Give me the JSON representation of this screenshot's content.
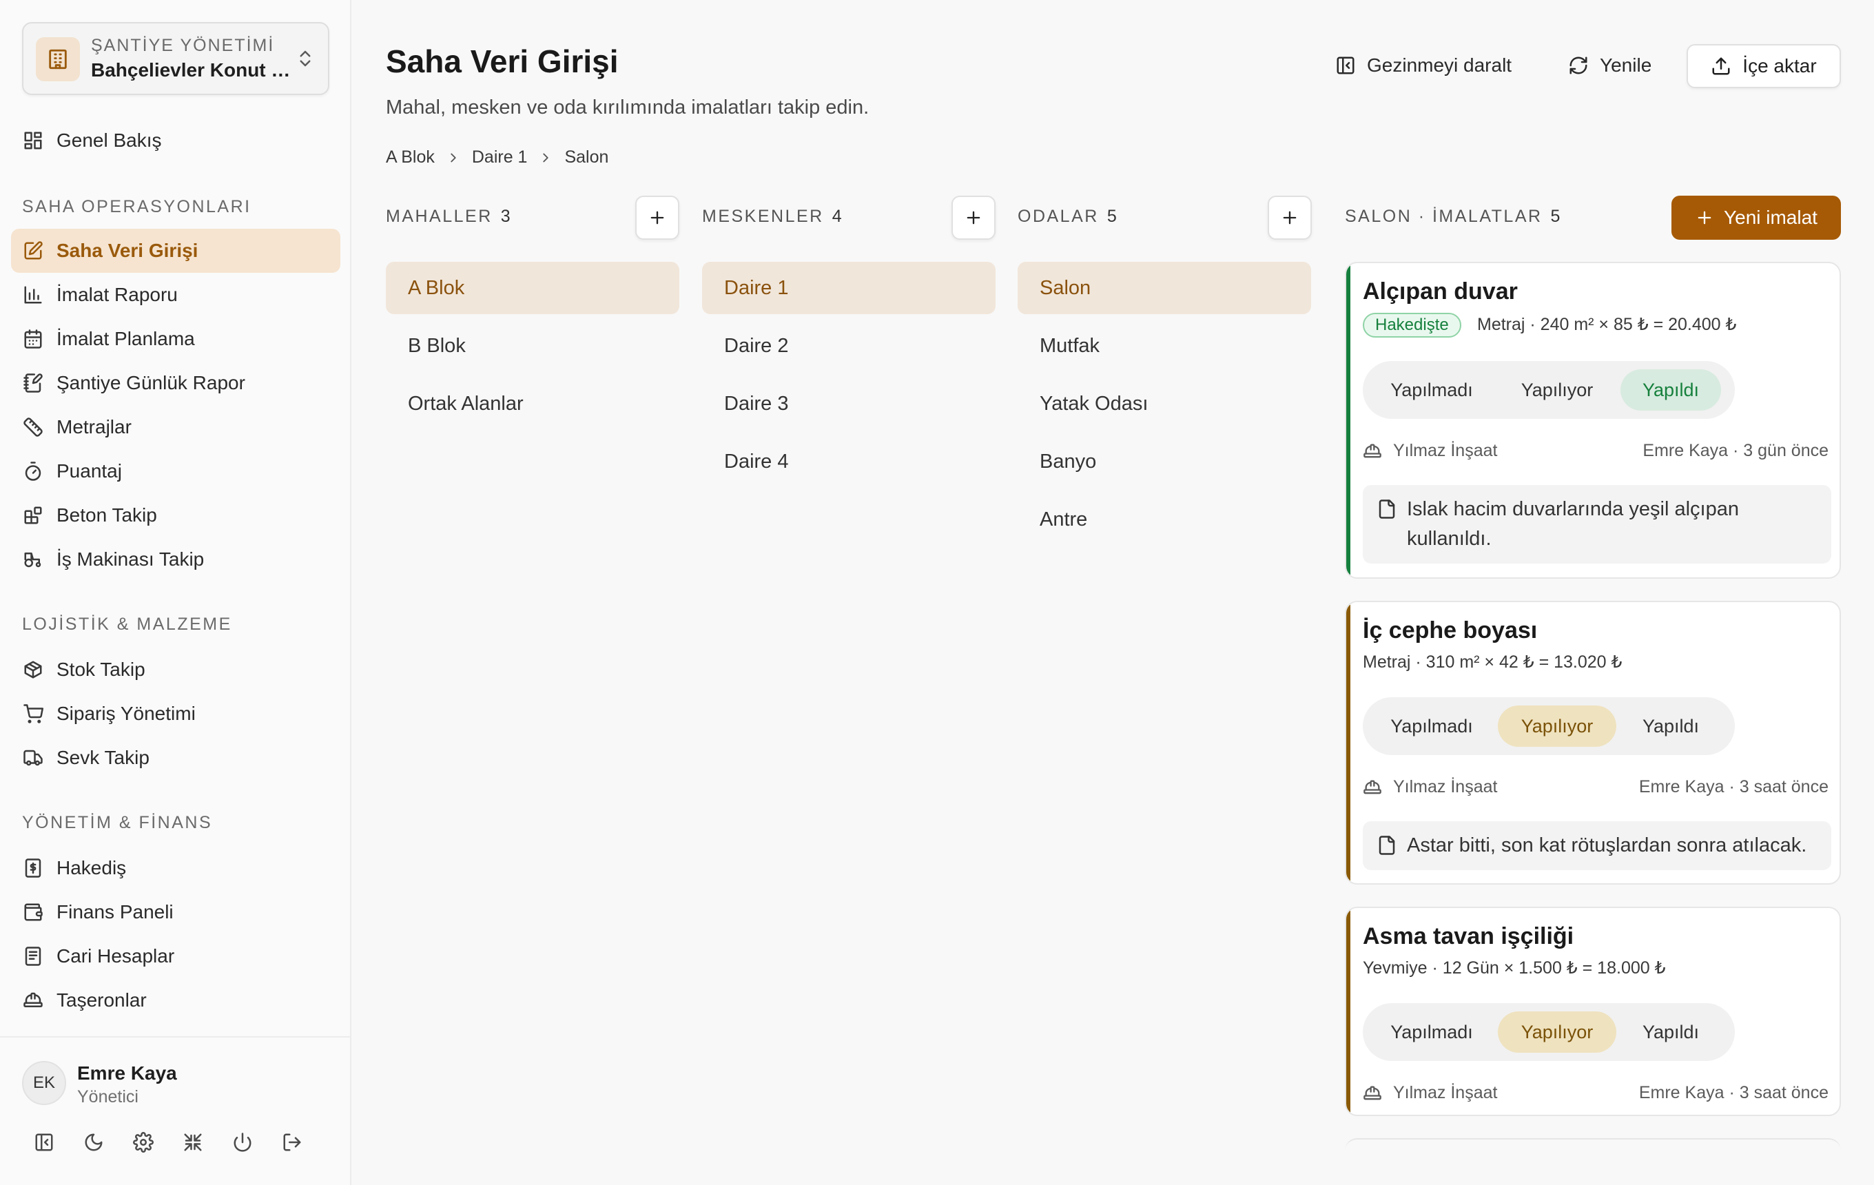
{
  "sidebar": {
    "project_kicker": "ŞANTİYE YÖNETİMİ",
    "project_name": "Bahçelievler Konut Projesi",
    "overview": "Genel Bakış",
    "section_ops": "SAHA OPERASYONLARI",
    "ops": [
      "Saha Veri Girişi",
      "İmalat Raporu",
      "İmalat Planlama",
      "Şantiye Günlük Rapor",
      "Metrajlar",
      "Puantaj",
      "Beton Takip",
      "İş Makinası Takip"
    ],
    "section_logistics": "LOJİSTİK & MALZEME",
    "logistics": [
      "Stok Takip",
      "Sipariş Yönetimi",
      "Sevk Takip"
    ],
    "section_finance": "YÖNETİM & FİNANS",
    "finance": [
      "Hakediş",
      "Finans Paneli",
      "Cari Hesaplar",
      "Taşeronlar"
    ],
    "user": {
      "initials": "EK",
      "name": "Emre Kaya",
      "role": "Yönetici"
    }
  },
  "header": {
    "title": "Saha Veri Girişi",
    "subtitle": "Mahal, mesken ve oda kırılımında imalatları takip edin.",
    "collapse_label": "Gezinmeyi daralt",
    "refresh_label": "Yenile",
    "export_label": "İçe aktar",
    "breadcrumb": [
      "A Blok",
      "Daire 1",
      "Salon"
    ]
  },
  "columns": {
    "mahaller": {
      "label": "MAHALLER",
      "count": "3",
      "items": [
        "A Blok",
        "B Blok",
        "Ortak Alanlar"
      ],
      "selected": 0
    },
    "meskenler": {
      "label": "MESKENLER",
      "count": "4",
      "items": [
        "Daire 1",
        "Daire 2",
        "Daire 3",
        "Daire 4"
      ],
      "selected": 0
    },
    "odalar": {
      "label": "ODALAR",
      "count": "5",
      "items": [
        "Salon",
        "Mutfak",
        "Yatak Odası",
        "Banyo",
        "Antre"
      ],
      "selected": 0
    },
    "imalatlar": {
      "label": "SALON · İMALATLAR",
      "count": "5",
      "new_label": "Yeni imalat"
    }
  },
  "segment_labels": [
    "Yapılmadı",
    "Yapılıyor",
    "Yapıldı"
  ],
  "cards": [
    {
      "title": "Alçıpan duvar",
      "badge": "Hakedişte",
      "meta": "Metraj · 240 m² × 85 ₺ = 20.400 ₺",
      "status": "Yapıldı",
      "contractor": "Yılmaz İnşaat",
      "updated": "Emre Kaya · 3 gün önce",
      "note": "Islak hacim duvarlarında yeşil alçıpan kullanıldı.",
      "accent": "#15803d"
    },
    {
      "title": "İç cephe boyası",
      "meta": "Metraj · 310 m² × 42 ₺ = 13.020 ₺",
      "status": "Yapılıyor",
      "contractor": "Yılmaz İnşaat",
      "updated": "Emre Kaya · 3 saat önce",
      "note": "Astar bitti, son kat rötuşlardan sonra atılacak.",
      "accent": "#8a5a05"
    },
    {
      "title": "Asma tavan işçiliği",
      "meta": "Yevmiye · 12 Gün × 1.500 ₺ = 18.000 ₺",
      "status": "Yapılıyor",
      "contractor": "Yılmaz İnşaat",
      "updated": "Emre Kaya · 3 saat önce",
      "accent": "#8a5a05"
    }
  ]
}
